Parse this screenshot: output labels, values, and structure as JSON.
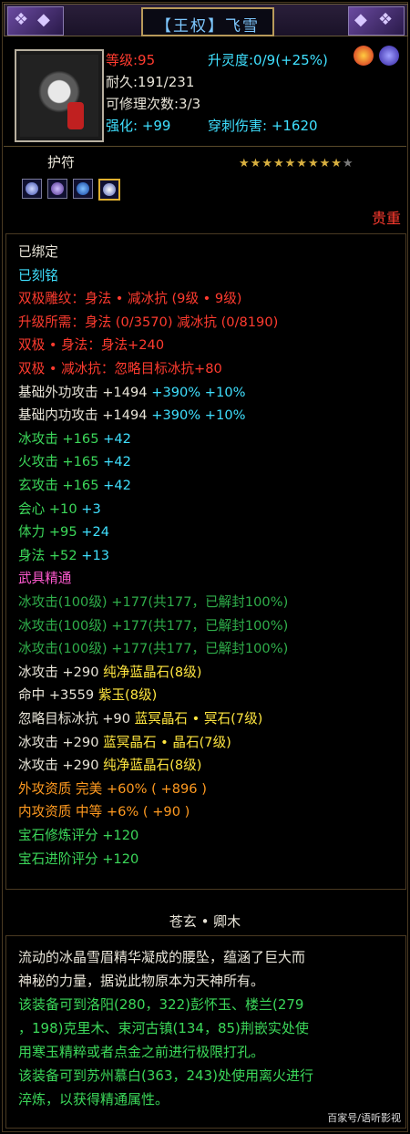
{
  "header": {
    "title": "【王权】飞雪"
  },
  "item": {
    "level": "等级:95",
    "spirit": "升灵度:0/9(+25%)",
    "durability": "耐久:191/231",
    "repairs": "可修理次数:3/3",
    "enhance": "强化: +99",
    "pierce": "穿刺伤害: +1620"
  },
  "amulet": {
    "label": "护符",
    "stars_filled": 9,
    "stars_total": 10,
    "precious": "贵重"
  },
  "stats": [
    {
      "text": "已绑定",
      "color": "white"
    },
    {
      "text": "已刻铭",
      "color": "cyan"
    },
    {
      "text": "双极雕纹：身法 • 减冰抗 (9级 • 9级)",
      "color": "red"
    },
    {
      "text": "升级所需：身法 (0/3570)   减冰抗 (0/8190)",
      "color": "red"
    },
    {
      "text": "双极 • 身法：身法+240",
      "color": "red"
    },
    {
      "text": "双极 • 减冰抗：忽略目标冰抗+80",
      "color": "red"
    },
    {
      "text": "基础外功攻击 +1494 +390% +10%",
      "color": "white",
      "parts": [
        "基础外功攻击 +1494 ",
        "+390% +10%"
      ]
    },
    {
      "text": "基础内功攻击 +1494 +390% +10%",
      "color": "white",
      "parts": [
        "基础内功攻击 +1494 ",
        "+390% +10%"
      ]
    },
    {
      "text": "冰攻击 +165 +42",
      "color": "green",
      "parts": [
        "冰攻击 +165 ",
        "+42"
      ]
    },
    {
      "text": "火攻击 +165 +42",
      "color": "green",
      "parts": [
        "火攻击 +165 ",
        "+42"
      ]
    },
    {
      "text": "玄攻击 +165 +42",
      "color": "green",
      "parts": [
        "玄攻击 +165 ",
        "+42"
      ]
    },
    {
      "text": "会心 +10 +3",
      "color": "green",
      "parts": [
        "会心 +10 ",
        "+3"
      ]
    },
    {
      "text": "体力 +95 +24",
      "color": "green",
      "parts": [
        "体力 +95 ",
        "+24"
      ]
    },
    {
      "text": "身法 +52 +13",
      "color": "green",
      "parts": [
        "身法 +52 ",
        "+13"
      ]
    },
    {
      "text": "武具精通",
      "color": "pink"
    },
    {
      "text": "冰攻击(100级) +177(共177，已解封100%)",
      "color": "dgreen"
    },
    {
      "text": "冰攻击(100级) +177(共177，已解封100%)",
      "color": "dgreen"
    },
    {
      "text": "冰攻击(100级) +177(共177，已解封100%)",
      "color": "dgreen"
    },
    {
      "text": "冰攻击 +290 纯净蓝晶石(8级)",
      "color": "white",
      "parts": [
        "冰攻击 +290 ",
        "纯净蓝晶石(8级)"
      ]
    },
    {
      "text": "命中 +3559 紫玉(8级)",
      "color": "white",
      "parts": [
        "命中 +3559 ",
        "紫玉(8级)"
      ]
    },
    {
      "text": "忽略目标冰抗 +90 蓝冥晶石 • 冥石(7级)",
      "color": "white",
      "parts": [
        "忽略目标冰抗 +90 ",
        "蓝冥晶石 • 冥石(7级)"
      ]
    },
    {
      "text": "冰攻击 +290 蓝冥晶石 • 晶石(7级)",
      "color": "white",
      "parts": [
        "冰攻击 +290 ",
        "蓝冥晶石 • 晶石(7级)"
      ]
    },
    {
      "text": "冰攻击 +290 纯净蓝晶石(8级)",
      "color": "white",
      "parts": [
        "冰攻击 +290 ",
        "纯净蓝晶石(8级)"
      ]
    },
    {
      "text": "外攻资质   完美 +60% ( +896 )",
      "color": "orange"
    },
    {
      "text": "内攻资质   中等 +6% ( +90 )",
      "color": "orange"
    },
    {
      "text": "宝石修炼评分 +120",
      "color": "green"
    },
    {
      "text": "宝石进阶评分 +120",
      "color": "green"
    }
  ],
  "set_name": "苍玄 • 卿木",
  "description": [
    {
      "text": "流动的冰晶雪眉精华凝成的腰坠，蕴涵了巨大而",
      "color": "white"
    },
    {
      "text": "神秘的力量，据说此物原本为天神所有。",
      "color": "white"
    },
    {
      "text": "该装备可到洛阳(280，322)彭怀玉、楼兰(279",
      "color": "green"
    },
    {
      "text": "，198)克里木、束河古镇(134，85)荆嵌实处使",
      "color": "green"
    },
    {
      "text": "用寒玉精粹或者点金之前进行极限打孔。",
      "color": "green"
    },
    {
      "text": "该装备可到苏州慕白(363，243)处使用离火进行",
      "color": "green"
    },
    {
      "text": "淬炼，以获得精通属性。",
      "color": "green"
    }
  ],
  "watermark": "百家号/语听影视",
  "colors": {
    "red": "#ff3b2f",
    "cyan": "#3fe0ff",
    "green": "#3cd85a",
    "gold": "#ffcc30",
    "pink": "#ff5ad0"
  }
}
